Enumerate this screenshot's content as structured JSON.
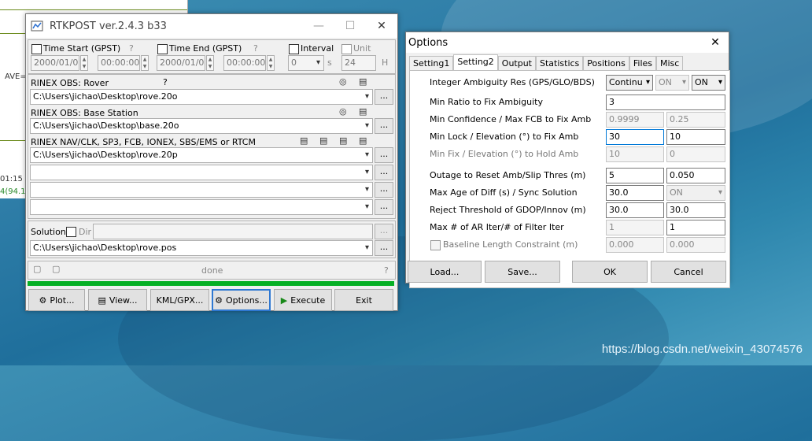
{
  "background": {
    "plot_ave_label": "AVE=",
    "plot_time_label": "01:15",
    "plot_value_label": "4(94.1",
    "watermark": "https://blog.csdn.net/weixin_43074576"
  },
  "rtkpost": {
    "title": "RTKPOST ver.2.4.3 b33",
    "time_start_label": "Time Start (GPST)",
    "time_start_help": "?",
    "time_start_date": "2000/01/01",
    "time_start_time": "00:00:00",
    "time_end_label": "Time End (GPST)",
    "time_end_help": "?",
    "time_end_date": "2000/01/01",
    "time_end_time": "00:00:00",
    "interval_label": "Interval",
    "interval_value": "0",
    "interval_unit": "s",
    "unit_label": "Unit",
    "unit_value": "24",
    "unit_suffix": "H",
    "rover_label": "RINEX OBS: Rover",
    "rover_help": "?",
    "rover_path": "C:\\Users\\jichao\\Desktop\\rove.20o",
    "base_label": "RINEX OBS: Base Station",
    "base_path": "C:\\Users\\jichao\\Desktop\\base.20o",
    "nav_label": "RINEX NAV/CLK, SP3, FCB, IONEX, SBS/EMS  or RTCM",
    "nav_path1": "C:\\Users\\jichao\\Desktop\\rove.20p",
    "nav_path2": "",
    "nav_path3": "",
    "nav_path4": "",
    "solution_label": "Solution",
    "dir_label": "Dir",
    "solution_path": "C:\\Users\\jichao\\Desktop\\rove.pos",
    "status_text": "done",
    "status_help": "?",
    "progress": 1.0,
    "browse_label": "...",
    "buttons": {
      "plot": "Plot...",
      "view": "View...",
      "kml": "KML/GPX...",
      "options": "Options...",
      "execute": "Execute",
      "exit": "Exit"
    }
  },
  "options": {
    "title": "Options",
    "tabs": [
      "Setting1",
      "Setting2",
      "Output",
      "Statistics",
      "Positions",
      "Files",
      "Misc"
    ],
    "active_tab": "Setting2",
    "rows": {
      "amb_res": {
        "label": "Integer Ambiguity Res (GPS/GLO/BDS)",
        "v1": "Continu",
        "v2": "ON",
        "v3": "ON"
      },
      "min_ratio": {
        "label": "Min Ratio to Fix Ambiguity",
        "v1": "3"
      },
      "min_conf": {
        "label": "Min Confidence / Max FCB to Fix Amb",
        "v1": "0.9999",
        "v2": "0.25"
      },
      "min_lock": {
        "label": "Min Lock / Elevation (°) to Fix Amb",
        "v1": "30",
        "v2": "10"
      },
      "min_fix": {
        "label": "Min Fix / Elevation (°) to Hold Amb",
        "v1": "10",
        "v2": "0"
      },
      "outage": {
        "label": "Outage to Reset Amb/Slip Thres (m)",
        "v1": "5",
        "v2": "0.050"
      },
      "max_age": {
        "label": "Max Age of Diff (s) / Sync Solution",
        "v1": "30.0",
        "v2": "ON"
      },
      "reject": {
        "label": "Reject Threshold of GDOP/Innov (m)",
        "v1": "30.0",
        "v2": "30.0"
      },
      "max_ar": {
        "label": "Max # of AR Iter/# of Filter Iter",
        "v1": "1",
        "v2": "1"
      },
      "baseline": {
        "label": "Baseline Length Constraint (m)",
        "v1": "0.000",
        "v2": "0.000"
      }
    },
    "buttons": {
      "load": "Load...",
      "save": "Save...",
      "ok": "OK",
      "cancel": "Cancel"
    }
  }
}
